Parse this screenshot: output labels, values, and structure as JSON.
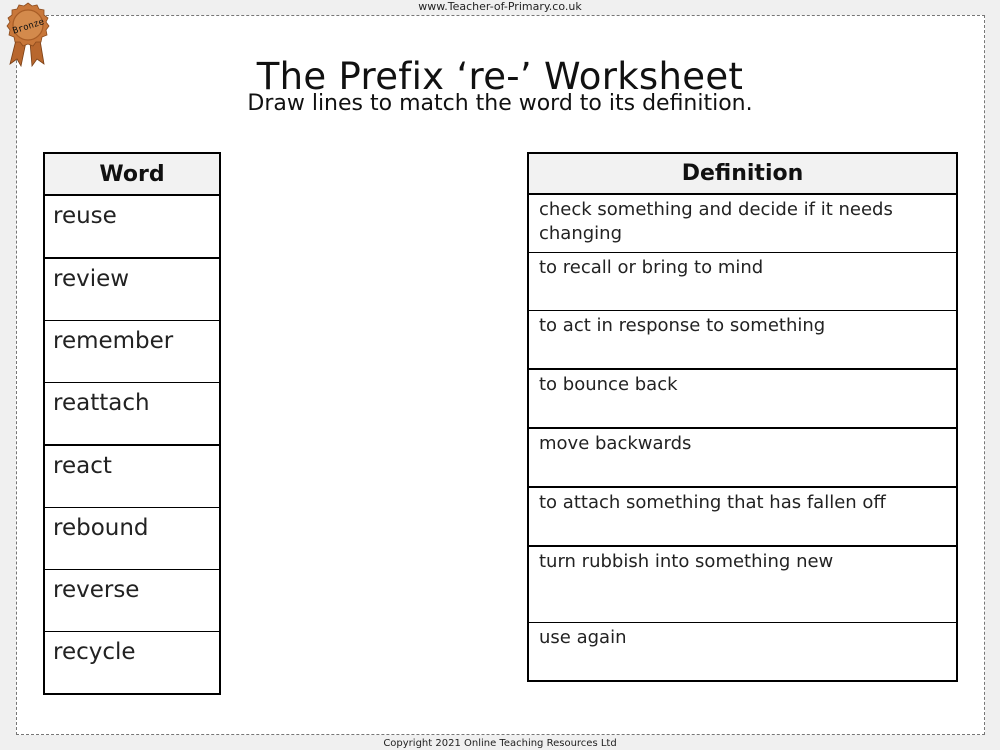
{
  "header": {
    "site_url": "www.Teacher-of-Primary.co.uk",
    "badge_label": "Bronze",
    "title": "The Prefix ‘re-’ Worksheet",
    "instruction": "Draw lines to match the word to its definition."
  },
  "word_table": {
    "header": "Word",
    "rows": [
      "reuse",
      "review",
      "remember",
      "reattach",
      "react",
      "rebound",
      "reverse",
      "recycle"
    ]
  },
  "definition_table": {
    "header": "Definition",
    "rows": [
      "check something and decide if it needs changing",
      "to recall or bring to mind",
      "to act in response to something",
      "to bounce back",
      "move backwards",
      "to attach something that has fallen off",
      "turn rubbish into something new",
      "use again"
    ]
  },
  "footer": {
    "copyright": "Copyright 2021 Online Teaching Resources Ltd"
  },
  "colors": {
    "badge_bronze": "#c8773a",
    "header_fill": "#f2f2f2",
    "page_background": "#f0f0f0"
  }
}
